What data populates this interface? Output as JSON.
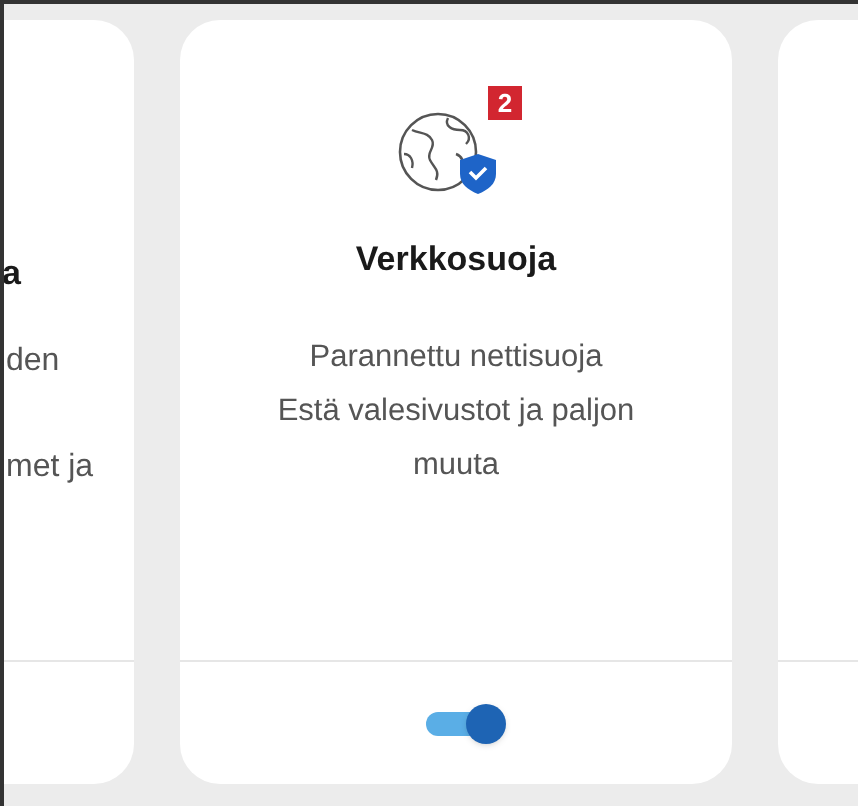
{
  "left_card": {
    "title": "a",
    "lines": [
      "den",
      "met ja"
    ]
  },
  "card": {
    "badge": "2",
    "title": "Verkkosuoja",
    "lines": [
      "Parannettu nettisuoja",
      "Estä valesivustot ja paljon",
      "muuta"
    ],
    "toggle": {
      "on": true
    }
  }
}
